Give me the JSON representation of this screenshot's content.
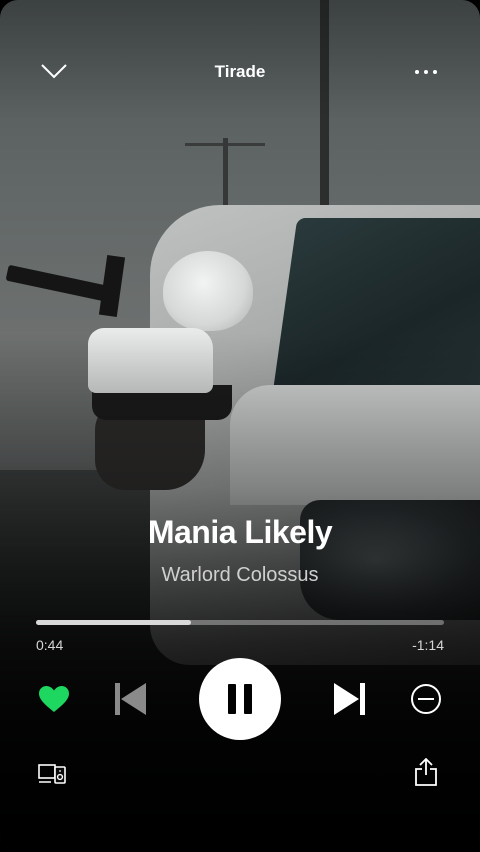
{
  "header": {
    "context_title": "Tirade",
    "collapse_icon": "chevron-down-icon",
    "more_icon": "more-horizontal-icon"
  },
  "track": {
    "title": "Mania Likely",
    "artist": "Warlord Colossus"
  },
  "progress": {
    "elapsed": "0:44",
    "remaining": "-1:14",
    "fraction": 0.38
  },
  "controls": {
    "like_icon": "heart-filled-icon",
    "prev_icon": "skip-previous-icon",
    "play_state_icon": "pause-icon",
    "next_icon": "skip-next-icon",
    "hide_icon": "minus-circle-icon"
  },
  "bottom": {
    "devices_icon": "devices-icon",
    "share_icon": "share-icon"
  },
  "colors": {
    "accent": "#1ed760",
    "text": "#ffffff",
    "subtext": "#cfcfcf"
  }
}
